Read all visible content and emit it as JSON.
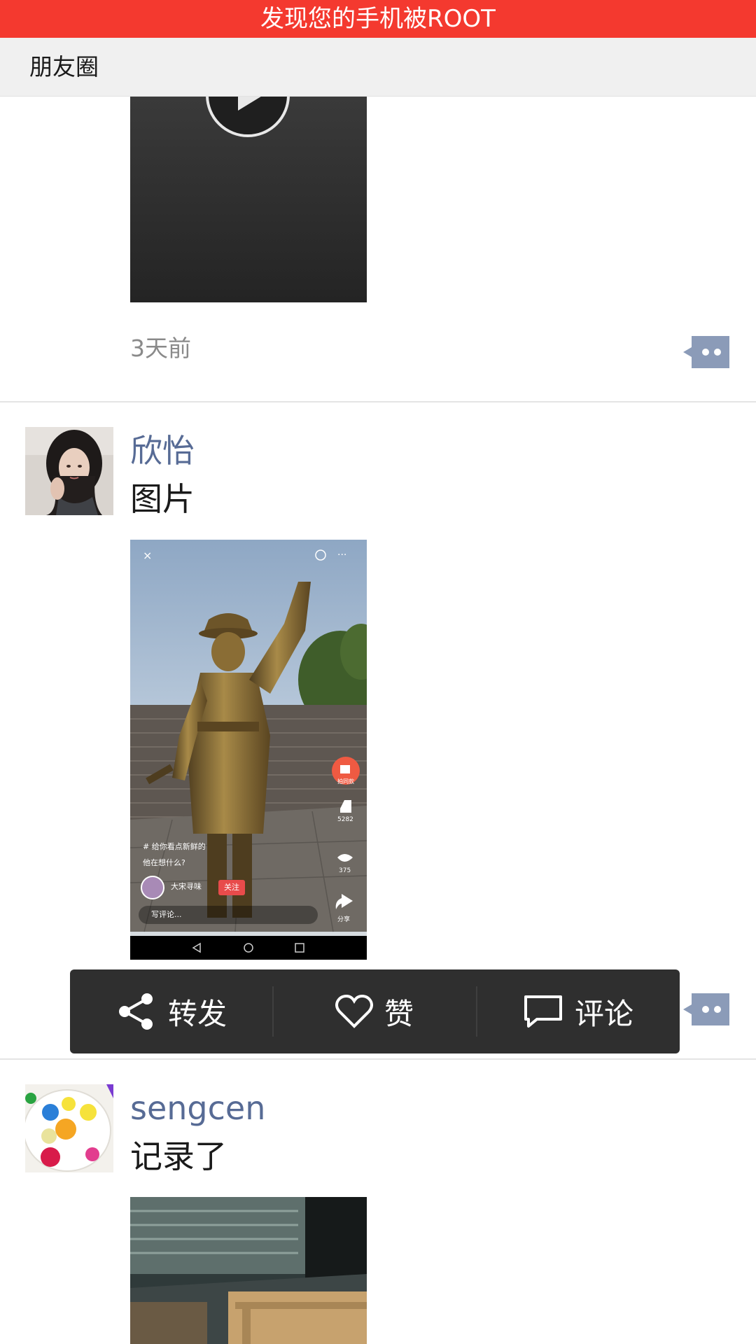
{
  "banner": {
    "text": "发现您的手机被ROOT"
  },
  "nav": {
    "title": "朋友圈"
  },
  "posts": [
    {
      "timestamp": "3天前",
      "media_type": "video",
      "icons": [
        "play-icon",
        "comment-dots-icon"
      ]
    },
    {
      "username": "欣怡",
      "text": "图片",
      "media": {
        "type": "image",
        "overlay": {
          "caption_line1": "# 给你看点新鲜的",
          "caption_line2": "他在想什么?",
          "author": "大宋寻味",
          "follow": "关注",
          "comment_hint": "写评论...",
          "side_top": "拍同款",
          "likes": "5282",
          "comments": "375",
          "share": "分享"
        }
      }
    },
    {
      "username": "sengcen",
      "text": "记录了"
    }
  ],
  "actions": {
    "repost": "转发",
    "like": "赞",
    "comment": "评论"
  }
}
